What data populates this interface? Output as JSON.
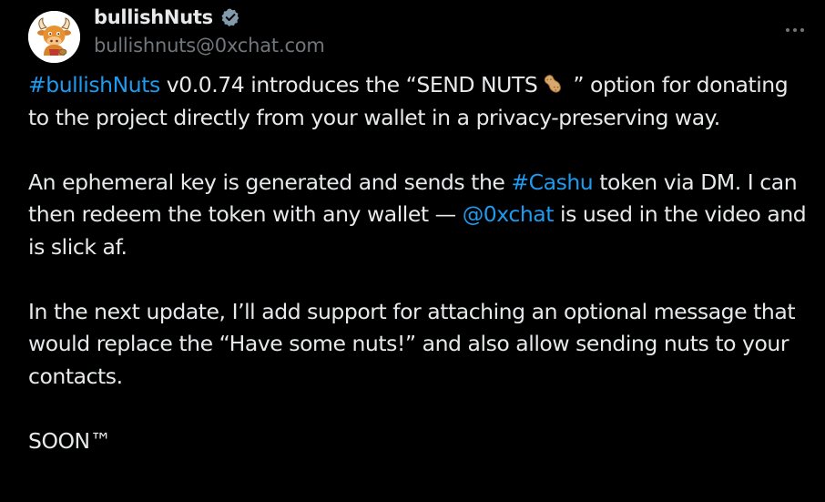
{
  "author": {
    "display_name": "bullishNuts",
    "handle": "bullishnuts@0xchat.com",
    "verified": true,
    "avatar_icon": "bull-mascot-avatar"
  },
  "menu": {
    "icon": "more-horizontal-icon"
  },
  "post": {
    "p1": {
      "hashtag": "#bullishNuts",
      "text_before_emoji": " v0.0.74 introduces the “SEND NUTS",
      "emoji": "peanut-icon",
      "text_after_emoji": " ” option for donating to the project directly from your wallet in a privacy-preserving way."
    },
    "p2": {
      "text_1": "An ephemeral key is generated and sends the ",
      "hashtag": "#Cashu",
      "text_2": " token via DM. I can then redeem the token with any wallet — ",
      "mention": "@0xchat",
      "text_3": " is used in the video and is slick af."
    },
    "p3": {
      "text": "In the next update, I’ll add support for attaching an optional message that would replace the “Have some nuts!” and also allow sending nuts to your contacts."
    },
    "p4": {
      "text": "SOON™"
    }
  },
  "colors": {
    "background": "#000000",
    "text": "#e7e9ea",
    "secondary": "#71767b",
    "link": "#1d9bf0"
  }
}
